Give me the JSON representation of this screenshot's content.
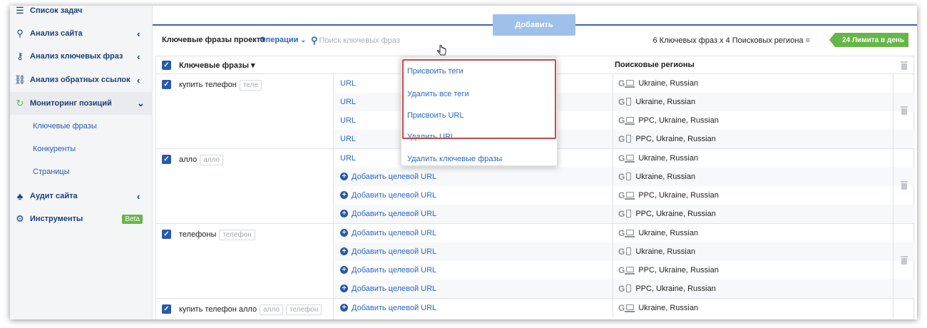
{
  "sidebar": {
    "items": [
      {
        "label": "Список задач",
        "icon": "list-icon"
      },
      {
        "label": "Анализ сайта",
        "icon": "site-analysis-icon"
      },
      {
        "label": "Анализ ключевых фраз",
        "icon": "key-icon"
      },
      {
        "label": "Анализ обратных ссылок",
        "icon": "link-icon"
      },
      {
        "label": "Мониторинг позиций",
        "icon": "refresh-icon"
      },
      {
        "label": "Аудит сайта",
        "icon": "sitemap-icon"
      },
      {
        "label": "Инструменты",
        "icon": "gear-icon"
      }
    ],
    "subitems": [
      "Ключевые фразы",
      "Конкуренты",
      "Страницы"
    ],
    "beta": "Beta"
  },
  "toolbar": {
    "add_button": "Добавить",
    "title": "Ключевые фразы проекта",
    "operations": "Операции",
    "search_placeholder": "Поиск ключевых фраз",
    "summary": "6 Ключевых фраз x 4 Поисковых региона =",
    "limit": "24 Лимита в день"
  },
  "table": {
    "col_phrases": "Ключевые фразы",
    "col_regions": "Поисковые регионы",
    "add_url": "Добавить целевой URL",
    "url_partial": "URL",
    "groups": [
      {
        "phrase": "купить телефон",
        "tags": [
          "теле"
        ],
        "regions": [
          "Ukraine, Russian",
          "Ukraine, Russian",
          "PPC, Ukraine, Russian",
          "PPC, Ukraine, Russian"
        ]
      },
      {
        "phrase": "алло",
        "tags": [
          "алло"
        ],
        "regions": [
          "Ukraine, Russian",
          "Ukraine, Russian",
          "PPC, Ukraine, Russian",
          "PPC, Ukraine, Russian"
        ]
      },
      {
        "phrase": "телефоны",
        "tags": [
          "телефон"
        ],
        "regions": [
          "Ukraine, Russian",
          "Ukraine, Russian",
          "PPC, Ukraine, Russian",
          "PPC, Ukraine, Russian"
        ]
      },
      {
        "phrase": "купить телефон алло",
        "tags": [
          "алло",
          "телефон"
        ],
        "regions": [
          "Ukraine, Russian"
        ]
      }
    ]
  },
  "dropdown": {
    "items": [
      "Присвоить теги",
      "Удалить все теги",
      "Присвоить URL",
      "Удалить URL",
      "Удалить ключевые фразы"
    ]
  },
  "colors": {
    "accent": "#2a68c6",
    "nav": "#1c3f78",
    "limit": "#67b648",
    "highlight": "#c9464b"
  }
}
